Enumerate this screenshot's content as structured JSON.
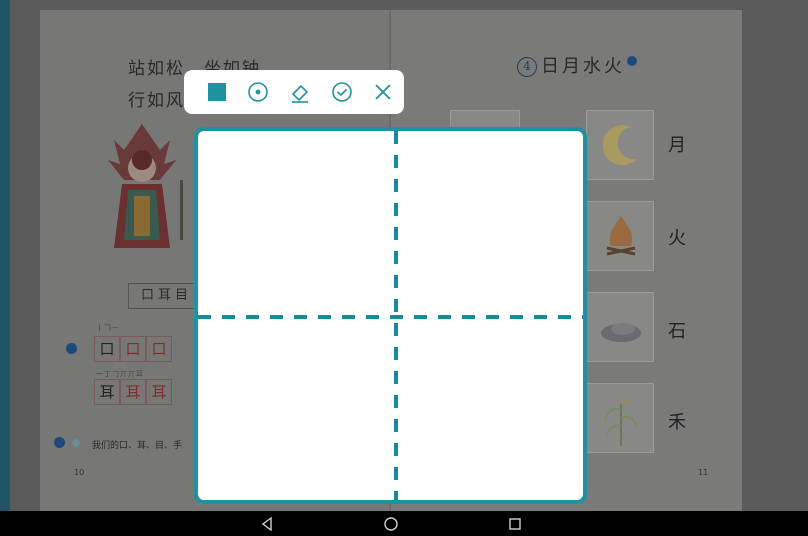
{
  "book": {
    "left_page": {
      "poem_line_1": "站如松，坐如钟。",
      "poem_line_2": "行如风",
      "word_box": "口耳目",
      "row1_strokes": "丨𠃍㇐",
      "row1_chars": [
        "口",
        "口",
        "口"
      ],
      "row2_strokes": "一丁𠃌丌丌耳",
      "row2_chars": [
        "耳",
        "耳",
        "耳"
      ],
      "footer_text": "我们的口、耳、目、手",
      "page_number": "10"
    },
    "right_page": {
      "lesson_number": "4",
      "lesson_title": "日月水火",
      "card_chars": [
        "月",
        "火",
        "石",
        "禾"
      ],
      "page_number": "11"
    }
  },
  "toolbar": {
    "tools": [
      {
        "name": "fill-square-icon",
        "label": "Fill color"
      },
      {
        "name": "pen-dot-icon",
        "label": "Pen"
      },
      {
        "name": "eraser-icon",
        "label": "Eraser"
      },
      {
        "name": "check-circle-icon",
        "label": "Confirm"
      },
      {
        "name": "close-icon",
        "label": "Close"
      }
    ]
  },
  "colors": {
    "accent": "#1d93a0",
    "guide_dash": "#168a99",
    "toolbar_bg": "#ffffff",
    "board_bg": "#ffffff",
    "overlay": "#5b5b5b"
  },
  "navbar": {
    "buttons": [
      "back-icon",
      "home-icon",
      "recents-icon"
    ]
  }
}
